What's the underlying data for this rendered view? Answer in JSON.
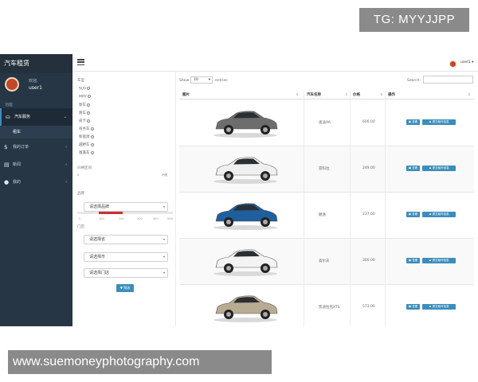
{
  "overlay": {
    "top_right": "TG: MYYJJPP",
    "bottom_left": "www.suemoneyphotography.com"
  },
  "sidebar": {
    "brand": "汽车租赁",
    "welcome": "欢迎,",
    "username": "user1",
    "section": "功能",
    "items": [
      {
        "label": "汽车服务",
        "icon": "car-icon",
        "active": true
      },
      {
        "label": "我的订单",
        "icon": "dollar-icon",
        "active": false
      },
      {
        "label": "新闻",
        "icon": "news-icon",
        "active": false
      },
      {
        "label": "我的",
        "icon": "user-icon",
        "active": false
      }
    ],
    "sub_item": "租车"
  },
  "topbar": {
    "user_menu": "user1 ▾"
  },
  "filter": {
    "type_label": "车型",
    "types": [
      "SUV",
      "MPV",
      "轿车",
      "跑车",
      "皮卡",
      "商务车",
      "新能源",
      "越野车",
      "敞篷车"
    ],
    "price_label": "价格区间",
    "slider_min_label": "0",
    "slider_max_label": "不限",
    "slider_low_value": "150",
    "slider_high_value": "300",
    "slider_ticks": [
      "0",
      "100",
      "200",
      "300",
      "400",
      "500"
    ],
    "brand_label": "品牌",
    "brand_select": "请选择品牌",
    "store_label": "门店",
    "province_select": "请选择省",
    "city_select": "请选择市",
    "store_select": "请选择门店",
    "filter_button": "筛选"
  },
  "table": {
    "show_label": "Show",
    "page_size": "10",
    "entries_label": "entries",
    "search_label": "Search:",
    "headers": [
      "图片",
      "汽车名称",
      "价格",
      "操作"
    ],
    "view_button": "查看",
    "rent_button": "提交租车信息",
    "rows": [
      {
        "name": "奥迪A6",
        "price": "600.00",
        "car_color": "#6d6d6d"
      },
      {
        "name": "昂科拉",
        "price": "249.00",
        "car_color": "#efefef"
      },
      {
        "name": "朗逸",
        "price": "237.00",
        "car_color": "#1f5f9e"
      },
      {
        "name": "高尔夫",
        "price": "300.00",
        "car_color": "#f3f3f3"
      },
      {
        "name": "凯迪拉克XTS",
        "price": "573.00",
        "car_color": "#b9ab92"
      }
    ]
  }
}
